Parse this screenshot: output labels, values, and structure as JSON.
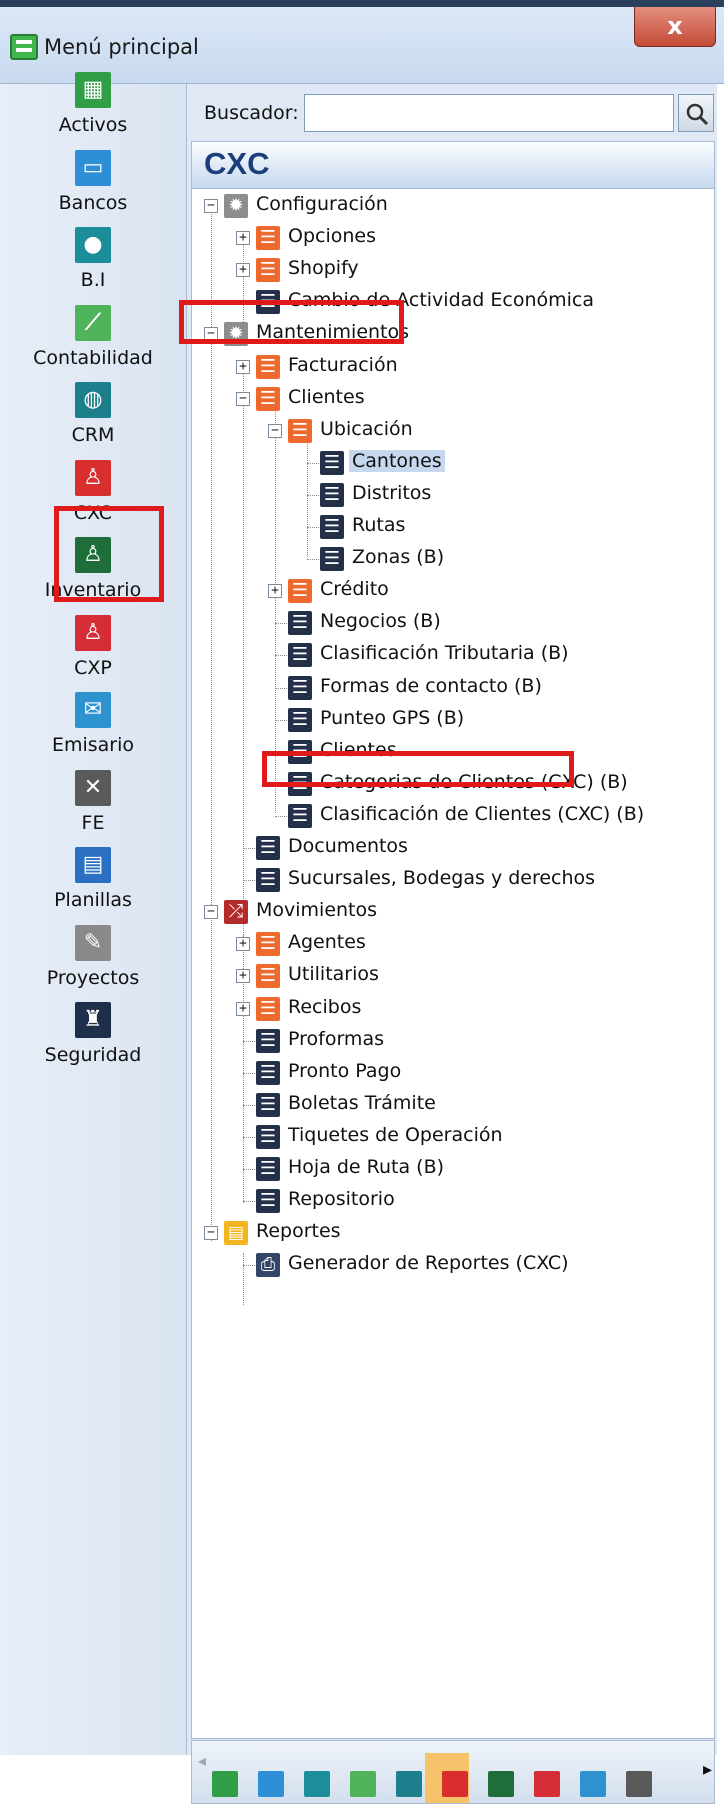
{
  "window": {
    "title": "Menú principal",
    "close_label": "x"
  },
  "sidebar": {
    "items": [
      {
        "label": "Activos",
        "icon": "register-icon",
        "glyph": "▦"
      },
      {
        "label": "Bancos",
        "icon": "briefcase-icon",
        "glyph": "▭"
      },
      {
        "label": "B.I",
        "icon": "bulb-icon",
        "glyph": "●"
      },
      {
        "label": "Contabilidad",
        "icon": "line-chart-icon",
        "glyph": "⟋"
      },
      {
        "label": "CRM",
        "icon": "globe-icon",
        "glyph": "◍"
      },
      {
        "label": "CXC",
        "icon": "person-icon",
        "glyph": "♙"
      },
      {
        "label": "Inventario",
        "icon": "person-cart-icon",
        "glyph": "♙"
      },
      {
        "label": "CXP",
        "icon": "person-money-icon",
        "glyph": "♙"
      },
      {
        "label": "Emisario",
        "icon": "envelope-icon",
        "glyph": "✉"
      },
      {
        "label": "FE",
        "icon": "tools-icon",
        "glyph": "✕"
      },
      {
        "label": "Planillas",
        "icon": "document-icon",
        "glyph": "▤"
      },
      {
        "label": "Proyectos",
        "icon": "pen-ruler-icon",
        "glyph": "✎"
      },
      {
        "label": "Seguridad",
        "icon": "castle-icon",
        "glyph": "♜"
      }
    ]
  },
  "search": {
    "label": "Buscador:",
    "value": "",
    "placeholder": ""
  },
  "module": {
    "title": "CXC"
  },
  "tree": {
    "nodes": [
      {
        "label": "Configuración",
        "icon": "gear-icon",
        "level": 0,
        "expander": "minus"
      },
      {
        "label": "Opciones",
        "icon": "list-orange-icon",
        "level": 1,
        "expander": "plus"
      },
      {
        "label": "Shopify",
        "icon": "list-orange-icon",
        "level": 1,
        "expander": "plus"
      },
      {
        "label": "Cambio de Actividad Económica",
        "icon": "list-dark-icon",
        "level": 1,
        "expander": "none"
      },
      {
        "label": "Mantenimientos",
        "icon": "gear-icon",
        "level": 0,
        "expander": "minus"
      },
      {
        "label": "Facturación",
        "icon": "list-orange-icon",
        "level": 1,
        "expander": "plus"
      },
      {
        "label": "Clientes",
        "icon": "list-orange-icon",
        "level": 1,
        "expander": "minus"
      },
      {
        "label": "Ubicación",
        "icon": "list-orange-icon",
        "level": 2,
        "expander": "minus"
      },
      {
        "label": "Cantones",
        "icon": "list-dark-icon",
        "level": 3,
        "expander": "none",
        "selected": true
      },
      {
        "label": "Distritos",
        "icon": "list-dark-icon",
        "level": 3,
        "expander": "none"
      },
      {
        "label": "Rutas",
        "icon": "list-dark-icon",
        "level": 3,
        "expander": "none"
      },
      {
        "label": "Zonas (B)",
        "icon": "list-dark-icon",
        "level": 3,
        "expander": "none"
      },
      {
        "label": "Crédito",
        "icon": "list-orange-icon",
        "level": 2,
        "expander": "plus"
      },
      {
        "label": "Negocios (B)",
        "icon": "list-dark-icon",
        "level": 2,
        "expander": "none"
      },
      {
        "label": "Clasificación Tributaria (B)",
        "icon": "list-dark-icon",
        "level": 2,
        "expander": "none"
      },
      {
        "label": "Formas de contacto (B)",
        "icon": "list-dark-icon",
        "level": 2,
        "expander": "none"
      },
      {
        "label": "Punteo GPS (B)",
        "icon": "list-dark-icon",
        "level": 2,
        "expander": "none"
      },
      {
        "label": "Clientes",
        "icon": "list-dark-icon",
        "level": 2,
        "expander": "none"
      },
      {
        "label": "Categorias de Clientes (CXC) (B)",
        "icon": "list-dark-icon",
        "level": 2,
        "expander": "none"
      },
      {
        "label": "Clasificación de Clientes (CXC) (B)",
        "icon": "list-dark-icon",
        "level": 2,
        "expander": "none"
      },
      {
        "label": "Documentos",
        "icon": "list-dark-icon",
        "level": 1,
        "expander": "none"
      },
      {
        "label": "Sucursales, Bodegas y derechos",
        "icon": "list-dark-icon",
        "level": 1,
        "expander": "none"
      },
      {
        "label": "Movimientos",
        "icon": "shuffle-icon",
        "level": 0,
        "expander": "minus"
      },
      {
        "label": "Agentes",
        "icon": "list-orange-icon",
        "level": 1,
        "expander": "plus"
      },
      {
        "label": "Utilitarios",
        "icon": "list-orange-icon",
        "level": 1,
        "expander": "plus"
      },
      {
        "label": "Recibos",
        "icon": "list-orange-icon",
        "level": 1,
        "expander": "plus"
      },
      {
        "label": "Proformas",
        "icon": "list-dark-icon",
        "level": 1,
        "expander": "none"
      },
      {
        "label": "Pronto Pago",
        "icon": "list-dark-icon",
        "level": 1,
        "expander": "none"
      },
      {
        "label": "Boletas Trámite",
        "icon": "list-dark-icon",
        "level": 1,
        "expander": "none"
      },
      {
        "label": "Tiquetes de Operación",
        "icon": "list-dark-icon",
        "level": 1,
        "expander": "none"
      },
      {
        "label": "Hoja de Ruta (B)",
        "icon": "list-dark-icon",
        "level": 1,
        "expander": "none"
      },
      {
        "label": "Repositorio",
        "icon": "list-dark-icon",
        "level": 1,
        "expander": "none"
      },
      {
        "label": "Reportes",
        "icon": "report-icon",
        "level": 0,
        "expander": "minus"
      },
      {
        "label": "Generador de Reportes (CXC)",
        "icon": "printer-icon",
        "level": 1,
        "expander": "none"
      }
    ]
  },
  "bottom_bar": {
    "icons": [
      "register-icon",
      "briefcase-icon",
      "bulb-icon",
      "line-chart-icon",
      "globe-icon",
      "person-icon",
      "person-cart-icon",
      "person-money-icon",
      "envelope-icon",
      "tools-icon"
    ],
    "active": "person-icon"
  },
  "colors": {
    "highlight_red": "#e01a1a",
    "tree_orange": "#ee6a2c",
    "tree_dark": "#24304a",
    "header_blue": "#1b3f7a",
    "selection": "#c7d8ee"
  }
}
